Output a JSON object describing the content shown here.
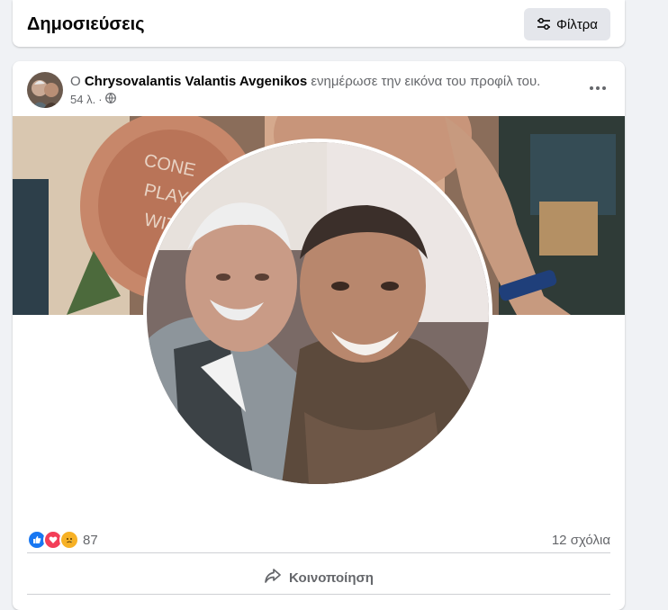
{
  "header": {
    "title": "Δημοσιεύσεις",
    "filter_label": "Φίλτρα",
    "filter_icon": "sliders-icon"
  },
  "post": {
    "prefix": "Ο",
    "author": "Chrysovalantis Valantis Avgenikos",
    "action": "ενημέρωσε την εικόνα του προφίλ του.",
    "time": "54 λ.",
    "separator": "·",
    "audience_icon": "globe-icon",
    "reactions": {
      "icons": [
        "like-reaction-icon",
        "love-reaction-icon",
        "sad-reaction-icon"
      ],
      "count": "87"
    },
    "comments": "12 σχόλια",
    "share_label": "Κοινοποίηση",
    "share_icon": "share-arrow-icon"
  },
  "colors": {
    "like": "#1877f2",
    "love": "#f33e58",
    "sad": "#f7b125",
    "page_bg": "#f0f2f5"
  }
}
